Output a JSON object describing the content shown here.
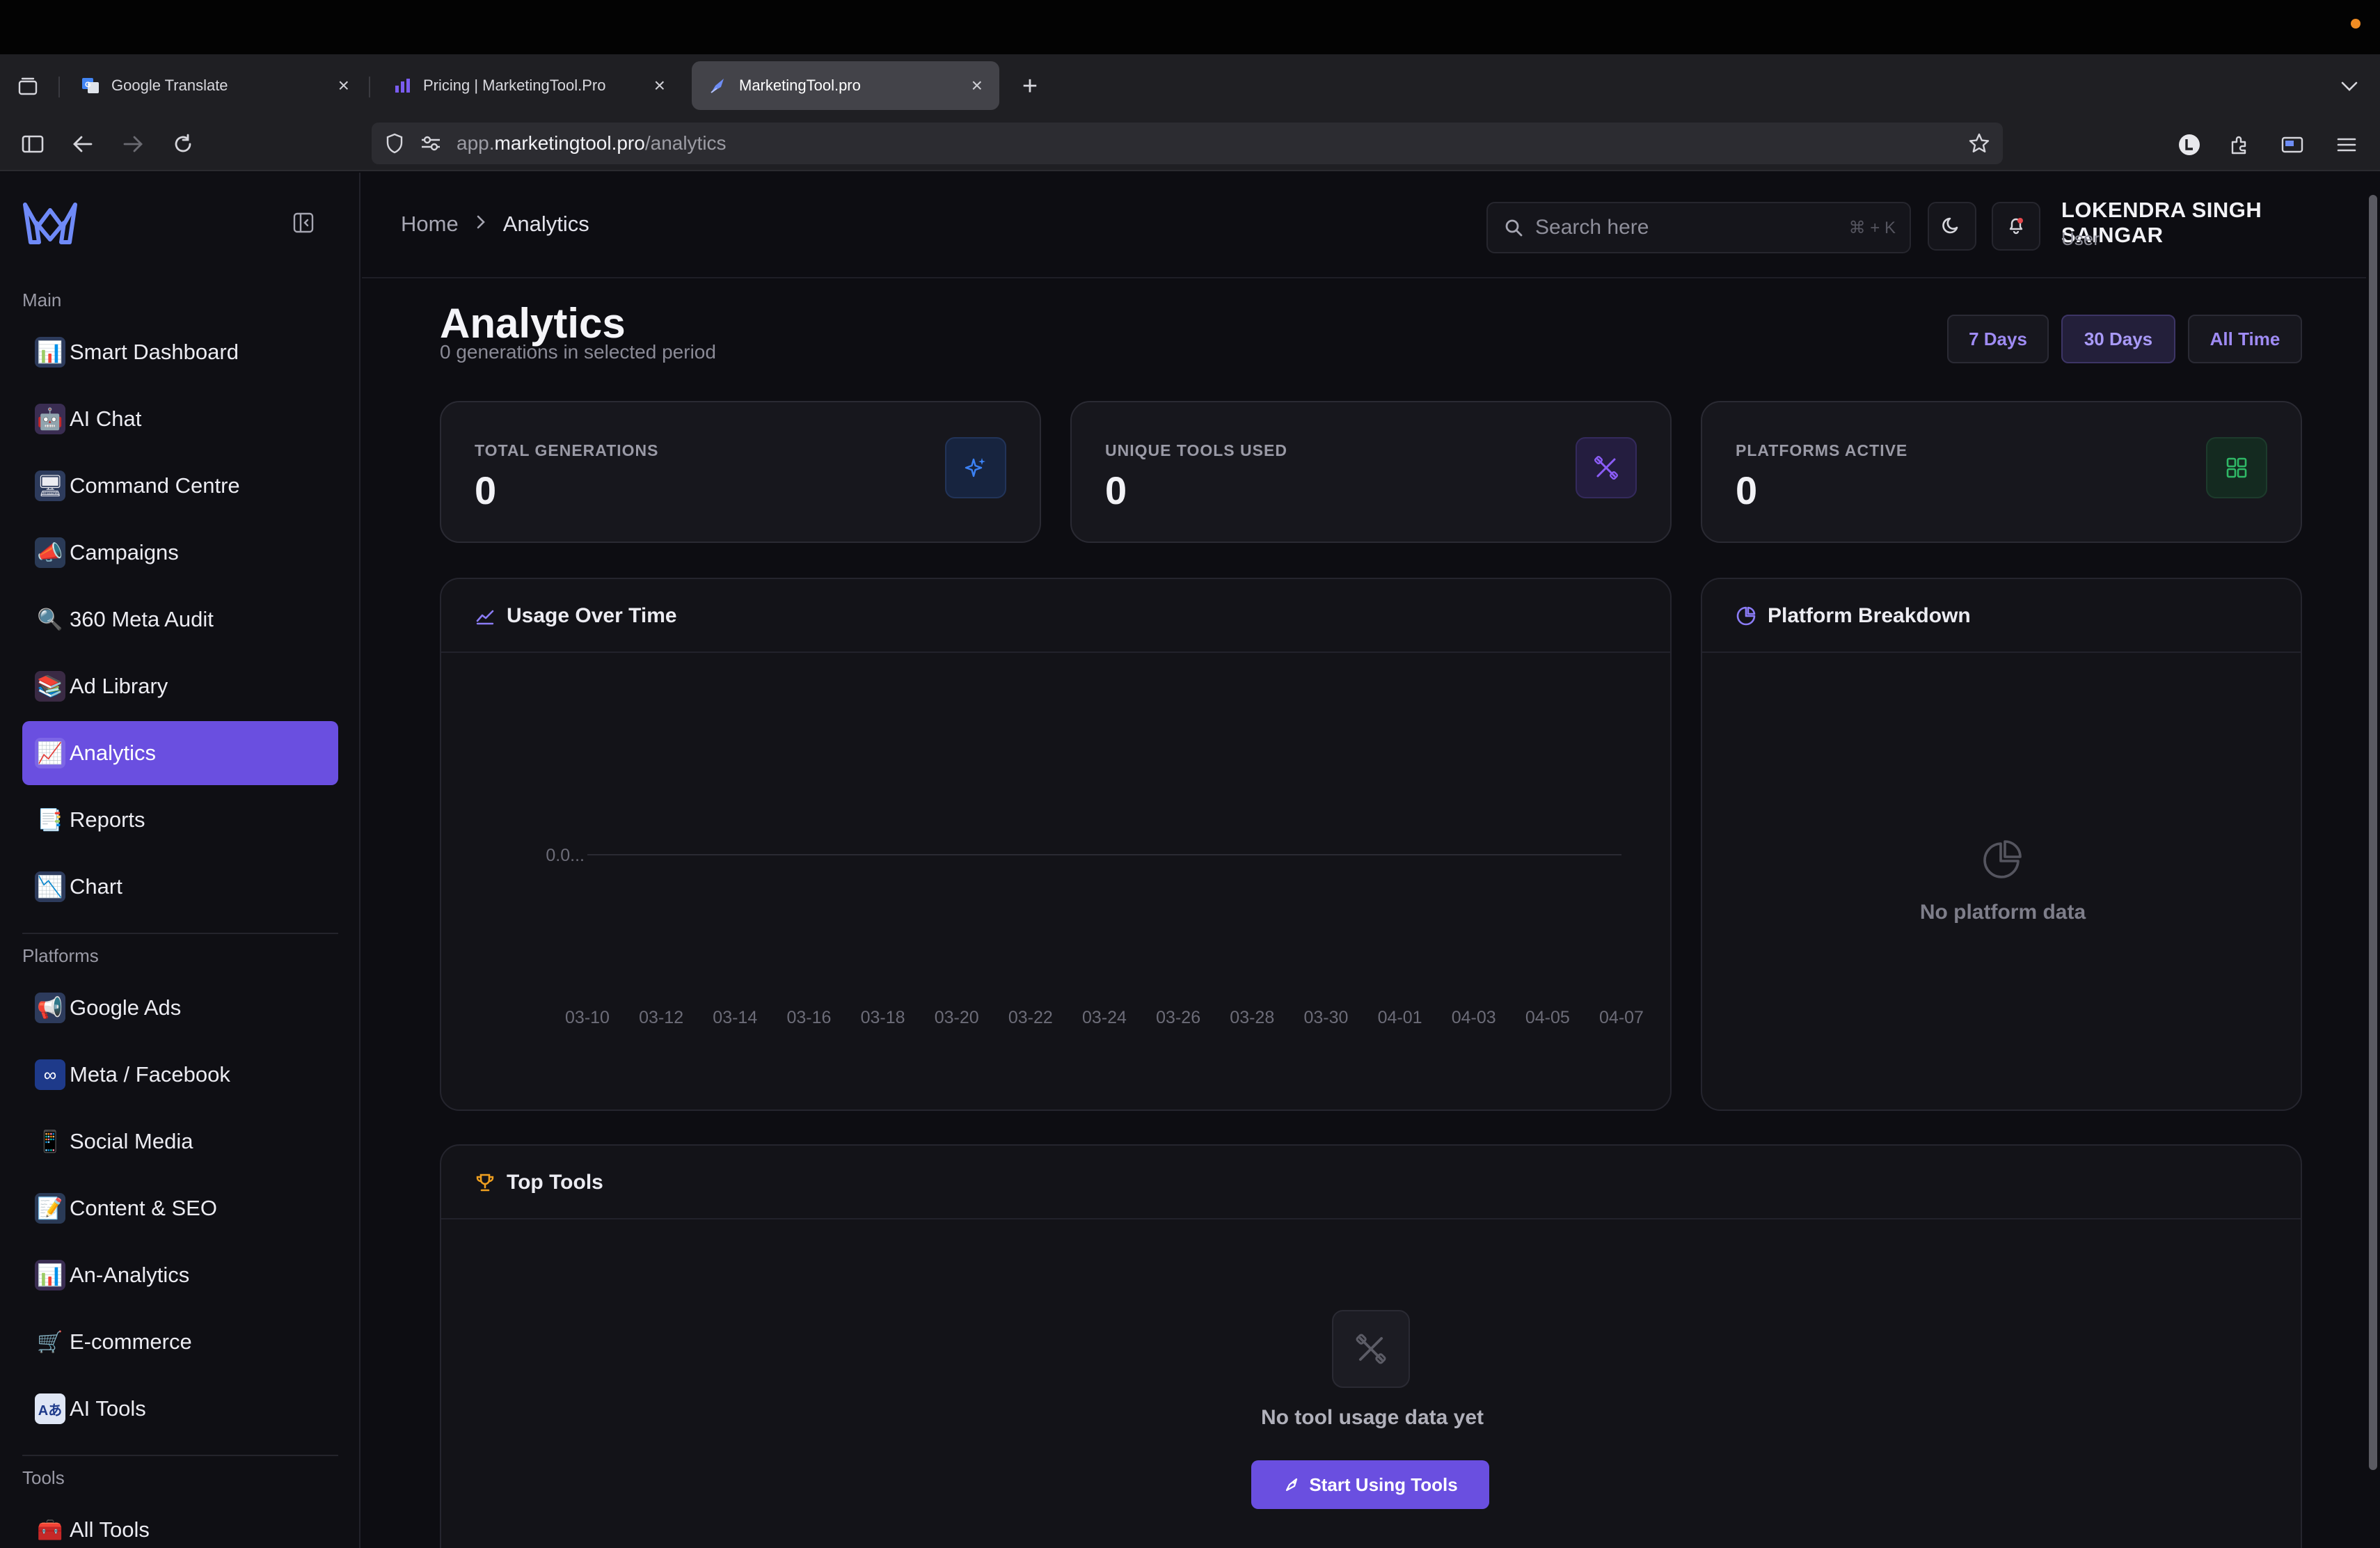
{
  "browser": {
    "tabs": [
      {
        "title": "Google Translate",
        "icon": "google-translate-icon"
      },
      {
        "title": "Pricing | MarketingTool.Pro",
        "icon": "chart-icon"
      },
      {
        "title": "MarketingTool.pro",
        "icon": "rocket-icon",
        "active": true
      }
    ],
    "url": {
      "prefix": "app.",
      "host": "marketingtool.pro",
      "path": "/analytics"
    }
  },
  "sidebar": {
    "sections": [
      {
        "label": "Main",
        "items": [
          "Smart Dashboard",
          "AI Chat",
          "Command Centre",
          "Campaigns",
          "360 Meta Audit",
          "Ad Library",
          "Analytics",
          "Reports",
          "Chart"
        ]
      },
      {
        "label": "Platforms",
        "items": [
          "Google Ads",
          "Meta / Facebook",
          "Social Media",
          "Content & SEO",
          "An-Analytics",
          "E-commerce",
          "AI Tools"
        ]
      },
      {
        "label": "Tools",
        "items": [
          "All Tools"
        ]
      }
    ],
    "active_item": "Analytics"
  },
  "header": {
    "breadcrumb": [
      "Home",
      "Analytics"
    ],
    "search_placeholder": "Search here",
    "search_shortcut": "⌘ + K",
    "user": {
      "name": "LOKENDRA SINGH SAINGAR",
      "role": "User"
    }
  },
  "page": {
    "title": "Analytics",
    "subtitle": "0 generations in selected period",
    "periods": [
      "7 Days",
      "30 Days",
      "All Time"
    ],
    "active_period": "30 Days"
  },
  "stats": [
    {
      "label": "TOTAL GENERATIONS",
      "value": "0",
      "icon": "sparkles-icon",
      "accent": "#3b6fe8"
    },
    {
      "label": "UNIQUE TOOLS USED",
      "value": "0",
      "icon": "tools-icon",
      "accent": "#8a5cf0"
    },
    {
      "label": "PLATFORMS ACTIVE",
      "value": "0",
      "icon": "grid-icon",
      "accent": "#2fb866"
    }
  ],
  "usage_panel": {
    "title": "Usage Over Time",
    "icon": "trend-line-icon"
  },
  "breakdown_panel": {
    "title": "Platform Breakdown",
    "icon": "pie-chart-icon",
    "empty_text": "No platform data"
  },
  "top_tools_panel": {
    "title": "Top Tools",
    "icon": "trophy-icon",
    "empty_text": "No tool usage data yet",
    "cta_label": "Start Using Tools"
  },
  "chart_data": {
    "type": "line",
    "title": "",
    "xlabel": "",
    "ylabel": "",
    "x": [
      "03-10",
      "03-12",
      "03-14",
      "03-16",
      "03-18",
      "03-20",
      "03-22",
      "03-24",
      "03-26",
      "03-28",
      "03-30",
      "04-01",
      "04-03",
      "04-05",
      "04-07"
    ],
    "y_ticks": [
      "0.0..."
    ],
    "series": [
      {
        "values": [
          0,
          0,
          0,
          0,
          0,
          0,
          0,
          0,
          0,
          0,
          0,
          0,
          0,
          0,
          0
        ]
      }
    ],
    "grid": true,
    "legend": "none"
  }
}
